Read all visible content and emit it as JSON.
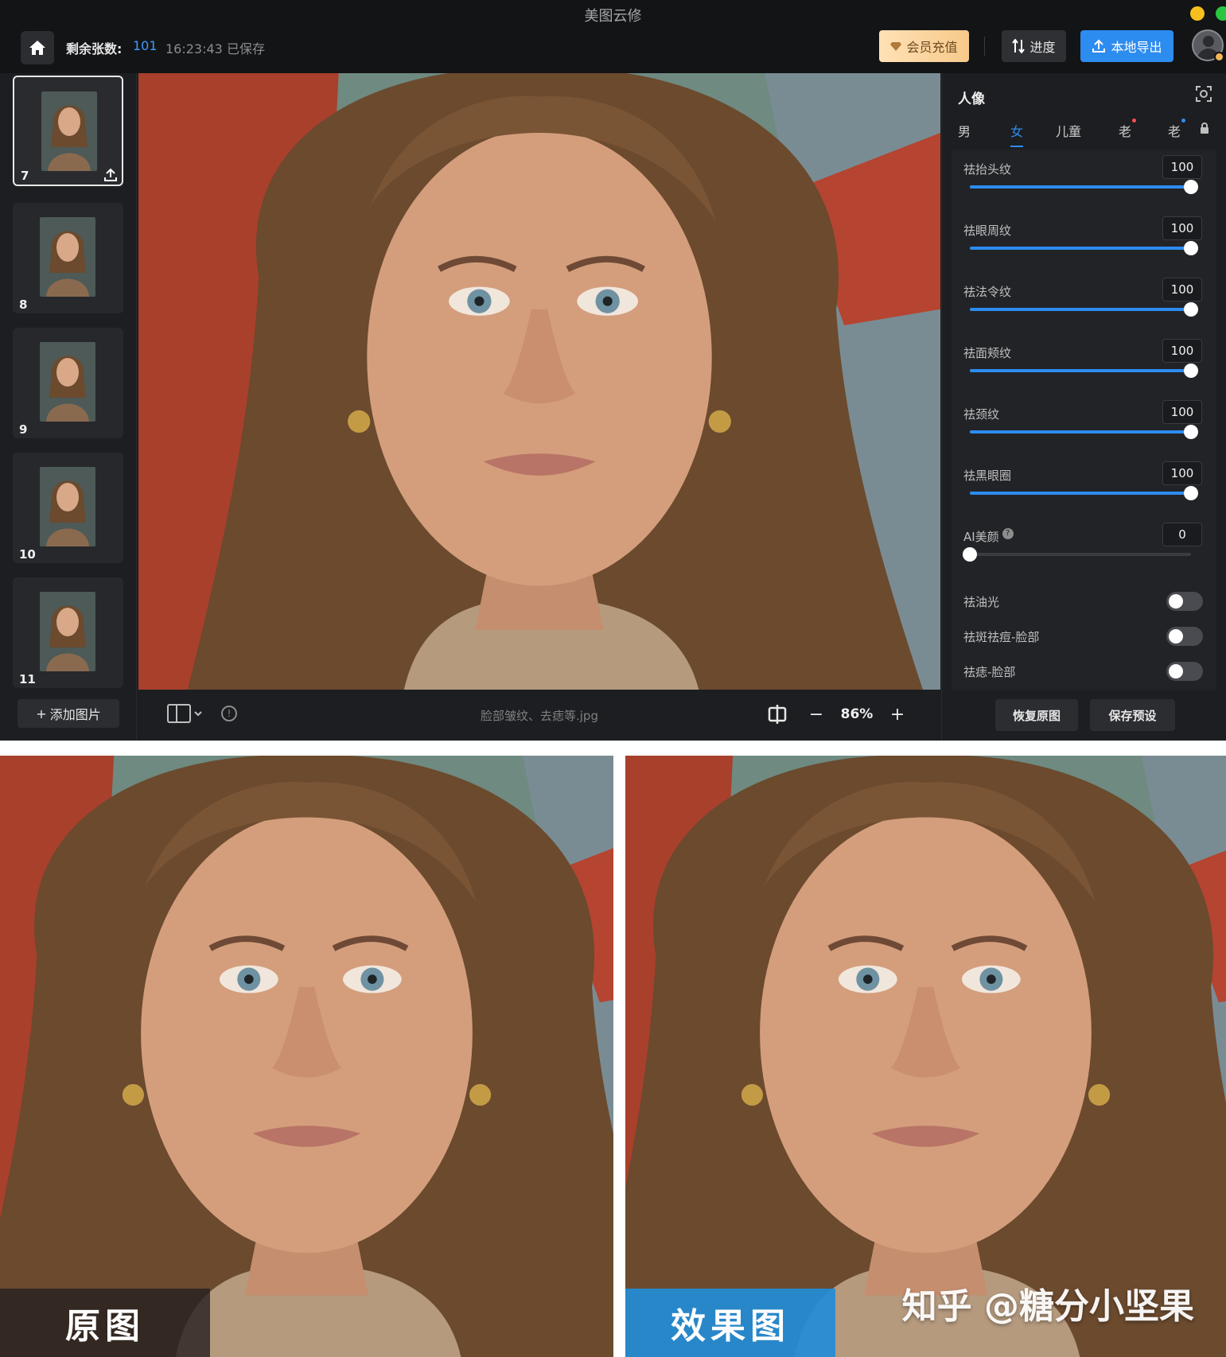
{
  "app": {
    "window_title": "美图云修",
    "remaining_label": "剩余张数:",
    "remaining_count": "101",
    "save_status": "16:23:43 已保存"
  },
  "toolbar": {
    "vip_label": "会员充值",
    "progress_label": "进度",
    "export_label": "本地导出"
  },
  "thumbnails": [
    {
      "number": "7",
      "selected": true,
      "icon": "upload-icon"
    },
    {
      "number": "8",
      "selected": false
    },
    {
      "number": "9",
      "selected": false
    },
    {
      "number": "10",
      "selected": false
    },
    {
      "number": "11",
      "selected": false
    }
  ],
  "add_image_label": "添加图片",
  "canvas": {
    "file_name": "脸部皱纹、去痣等.jpg",
    "zoom": "86%",
    "zoom_minus": "−",
    "zoom_plus": "+"
  },
  "panel": {
    "title": "人像",
    "tabs": [
      {
        "label": "男",
        "active": false
      },
      {
        "label": "女",
        "active": true
      },
      {
        "label": "儿童",
        "active": false
      },
      {
        "label": "老",
        "active": false
      },
      {
        "label": "老",
        "active": false
      }
    ],
    "sliders": [
      {
        "label": "祛抬头纹",
        "value": 100
      },
      {
        "label": "祛眼周纹",
        "value": 100
      },
      {
        "label": "祛法令纹",
        "value": 100
      },
      {
        "label": "祛面颊纹",
        "value": 100
      },
      {
        "label": "祛颈纹",
        "value": 100
      },
      {
        "label": "祛黑眼圈",
        "value": 100
      },
      {
        "label": "AI美颜",
        "value": 0
      }
    ],
    "toggles": [
      {
        "label": "祛油光",
        "on": false
      },
      {
        "label": "祛斑祛痘-脸部",
        "on": false
      },
      {
        "label": "祛痣-脸部",
        "on": false
      }
    ],
    "restore_label": "恢复原图",
    "save_preset_label": "保存预设"
  },
  "comparison": {
    "before_label": "原图",
    "after_label": "效果图",
    "watermark": "知乎 @糖分小坚果"
  },
  "colors": {
    "accent": "#2d8cf0",
    "background": "#1d1e21",
    "vip_gold": "#f7c98a"
  }
}
